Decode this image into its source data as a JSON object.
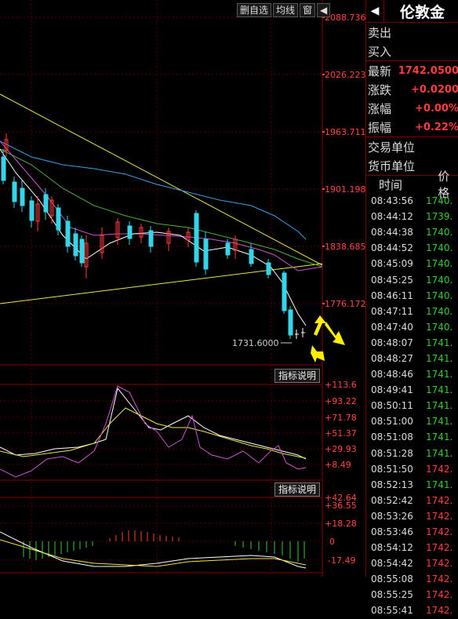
{
  "toolbar": {
    "btn1": "删自选",
    "btn2": "均线",
    "btn3": "窗",
    "btn4": "◀"
  },
  "main_chart": {
    "y_labels": [
      "2088.736",
      "2026.223",
      "1963.711",
      "1901.198",
      "1838.685",
      "1776.172"
    ],
    "low_marker": "1731.6000"
  },
  "indicator1": {
    "button": "指标说明",
    "y_labels": [
      "+113.6",
      "+93.22",
      "+71.78",
      "+51.37",
      "+29.93",
      "+8.49"
    ]
  },
  "indicator2": {
    "button": "指标说明",
    "y_labels": [
      "+42.64",
      "+36.55",
      "+18.28",
      "0",
      "-17.49"
    ]
  },
  "panel": {
    "title": "伦敦金",
    "prev_arrow": "◀",
    "rows": [
      {
        "label": "卖出",
        "value": ""
      },
      {
        "label": "买入",
        "value": ""
      },
      {
        "label": "最新",
        "value": "1742.0500"
      },
      {
        "label": "涨跌",
        "value": "+0.0200"
      },
      {
        "label": "涨幅",
        "value": "+0.00%"
      },
      {
        "label": "振幅",
        "value": "+0.22%"
      },
      {
        "label": "交易单位",
        "value": ""
      },
      {
        "label": "货币单位",
        "value": ""
      }
    ],
    "ticks_header": {
      "time": "时间",
      "price": "价格"
    },
    "ticks": [
      {
        "time": "08:43:56",
        "price": "1740.",
        "color": "green"
      },
      {
        "time": "08:44:12",
        "price": "1739.",
        "color": "green"
      },
      {
        "time": "08:44:38",
        "price": "1740.",
        "color": "green"
      },
      {
        "time": "08:44:52",
        "price": "1740.",
        "color": "green"
      },
      {
        "time": "08:45:09",
        "price": "1740.",
        "color": "green"
      },
      {
        "time": "08:45:25",
        "price": "1740.",
        "color": "green"
      },
      {
        "time": "08:46:11",
        "price": "1740.",
        "color": "green"
      },
      {
        "time": "08:47:11",
        "price": "1740.",
        "color": "green"
      },
      {
        "time": "08:47:40",
        "price": "1740.",
        "color": "green"
      },
      {
        "time": "08:48:07",
        "price": "1741.",
        "color": "green"
      },
      {
        "time": "08:48:27",
        "price": "1741.",
        "color": "green"
      },
      {
        "time": "08:48:46",
        "price": "1741.",
        "color": "green"
      },
      {
        "time": "08:49:41",
        "price": "1741.",
        "color": "green"
      },
      {
        "time": "08:50:11",
        "price": "1741.",
        "color": "green"
      },
      {
        "time": "08:51:00",
        "price": "1741.",
        "color": "green"
      },
      {
        "time": "08:51:08",
        "price": "1741.",
        "color": "green"
      },
      {
        "time": "08:51:28",
        "price": "1741.",
        "color": "green"
      },
      {
        "time": "08:51:50",
        "price": "1742.",
        "color": "red"
      },
      {
        "time": "08:52:13",
        "price": "1741.",
        "color": "green"
      },
      {
        "time": "08:52:42",
        "price": "1742.",
        "color": "red"
      },
      {
        "time": "08:53:26",
        "price": "1742.",
        "color": "red"
      },
      {
        "time": "08:53:46",
        "price": "1742.",
        "color": "red"
      },
      {
        "time": "08:54:12",
        "price": "1742.",
        "color": "red"
      },
      {
        "time": "08:54:42",
        "price": "1742.",
        "color": "red"
      },
      {
        "time": "08:55:08",
        "price": "1742.",
        "color": "red"
      },
      {
        "time": "08:55:25",
        "price": "1742.",
        "color": "red"
      },
      {
        "time": "08:55:41",
        "price": "1742.",
        "color": "red"
      }
    ]
  }
}
